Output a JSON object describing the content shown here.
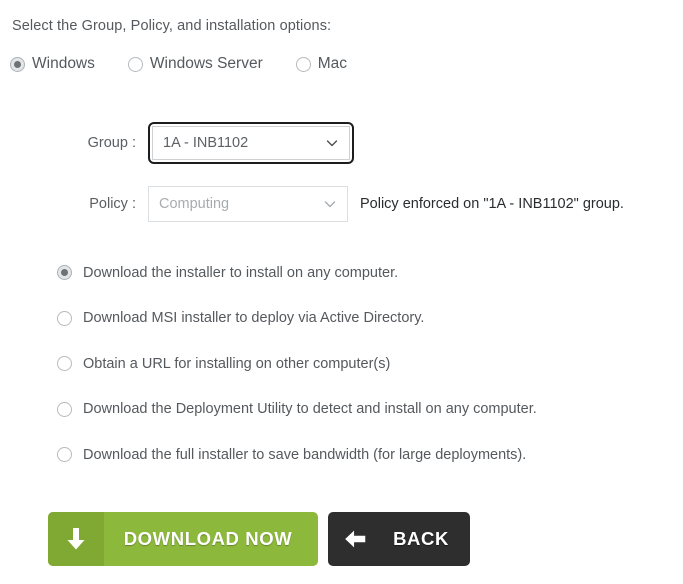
{
  "intro": "Select the Group, Policy, and installation options:",
  "platforms": {
    "options": [
      {
        "label": "Windows",
        "selected": true
      },
      {
        "label": "Windows Server",
        "selected": false
      },
      {
        "label": "Mac",
        "selected": false
      }
    ]
  },
  "group_field": {
    "label": "Group :",
    "value": "1A - INB1102",
    "focused": true,
    "enabled": true
  },
  "policy_field": {
    "label": "Policy :",
    "value": "Computing",
    "enabled": false,
    "note": "Policy enforced on \"1A - INB1102\" group."
  },
  "install_options": [
    {
      "label": "Download the installer to install on any computer.",
      "selected": true
    },
    {
      "label": "Download MSI installer to deploy via Active Directory.",
      "selected": false
    },
    {
      "label": "Obtain a URL for installing on other computer(s)",
      "selected": false
    },
    {
      "label": "Download the Deployment Utility to detect and install on any computer.",
      "selected": false
    },
    {
      "label": "Download the full installer to save bandwidth (for large deployments).",
      "selected": false
    }
  ],
  "buttons": {
    "download": {
      "label": "DOWNLOAD NOW",
      "icon": "download-arrow-icon",
      "color": "#8cb83c",
      "icon_color": "#80a933"
    },
    "back": {
      "label": "BACK",
      "icon": "left-arrow-icon",
      "color": "#2e2e2e"
    }
  },
  "colors": {
    "text": "#55595d",
    "note_text": "#2a2d30",
    "disabled_text": "#a8acaf",
    "focus_border": "#1d1d1d",
    "field_border": "#cfd2d4"
  }
}
